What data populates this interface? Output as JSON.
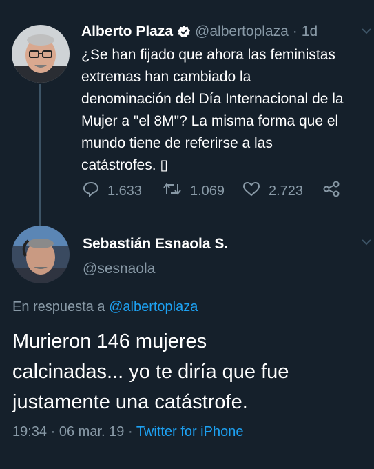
{
  "original_tweet": {
    "author_name": "Alberto Plaza",
    "handle": "@albertoplaza",
    "separator": "·",
    "age": "1d",
    "text_lines": [
      "¿Se han fijado que ahora las feministas",
      "extremas han cambiado la",
      "denominación del Día Internacional de la",
      "Mujer a \"el 8M\"? La misma forma que el",
      "mundo tiene de referirse a las",
      "catástrofes. ▯"
    ],
    "replies": "1.633",
    "retweets": "1.069",
    "likes": "2.723",
    "verified": true
  },
  "reply_tweet": {
    "author_name": "Sebastián Esnaola S.",
    "handle": "@sesnaola",
    "in_reply_prefix": "En respuesta a",
    "in_reply_handle": "@albertoplaza",
    "text_lines": [
      "Murieron 146 mujeres",
      "calcinadas... yo te diría que fue",
      "justamente una catástrofe."
    ],
    "time": "19:34",
    "dot1": "·",
    "date": "06 mar. 19",
    "dot2": "·",
    "client": "Twitter for iPhone"
  },
  "colors": {
    "background": "#15202b",
    "secondary_text": "#8899a6",
    "link": "#1da1f2",
    "thread_line": "#3d5466"
  },
  "icons": [
    "verified-badge-icon",
    "chevron-down-icon",
    "reply-icon",
    "retweet-icon",
    "like-icon",
    "share-icon"
  ]
}
